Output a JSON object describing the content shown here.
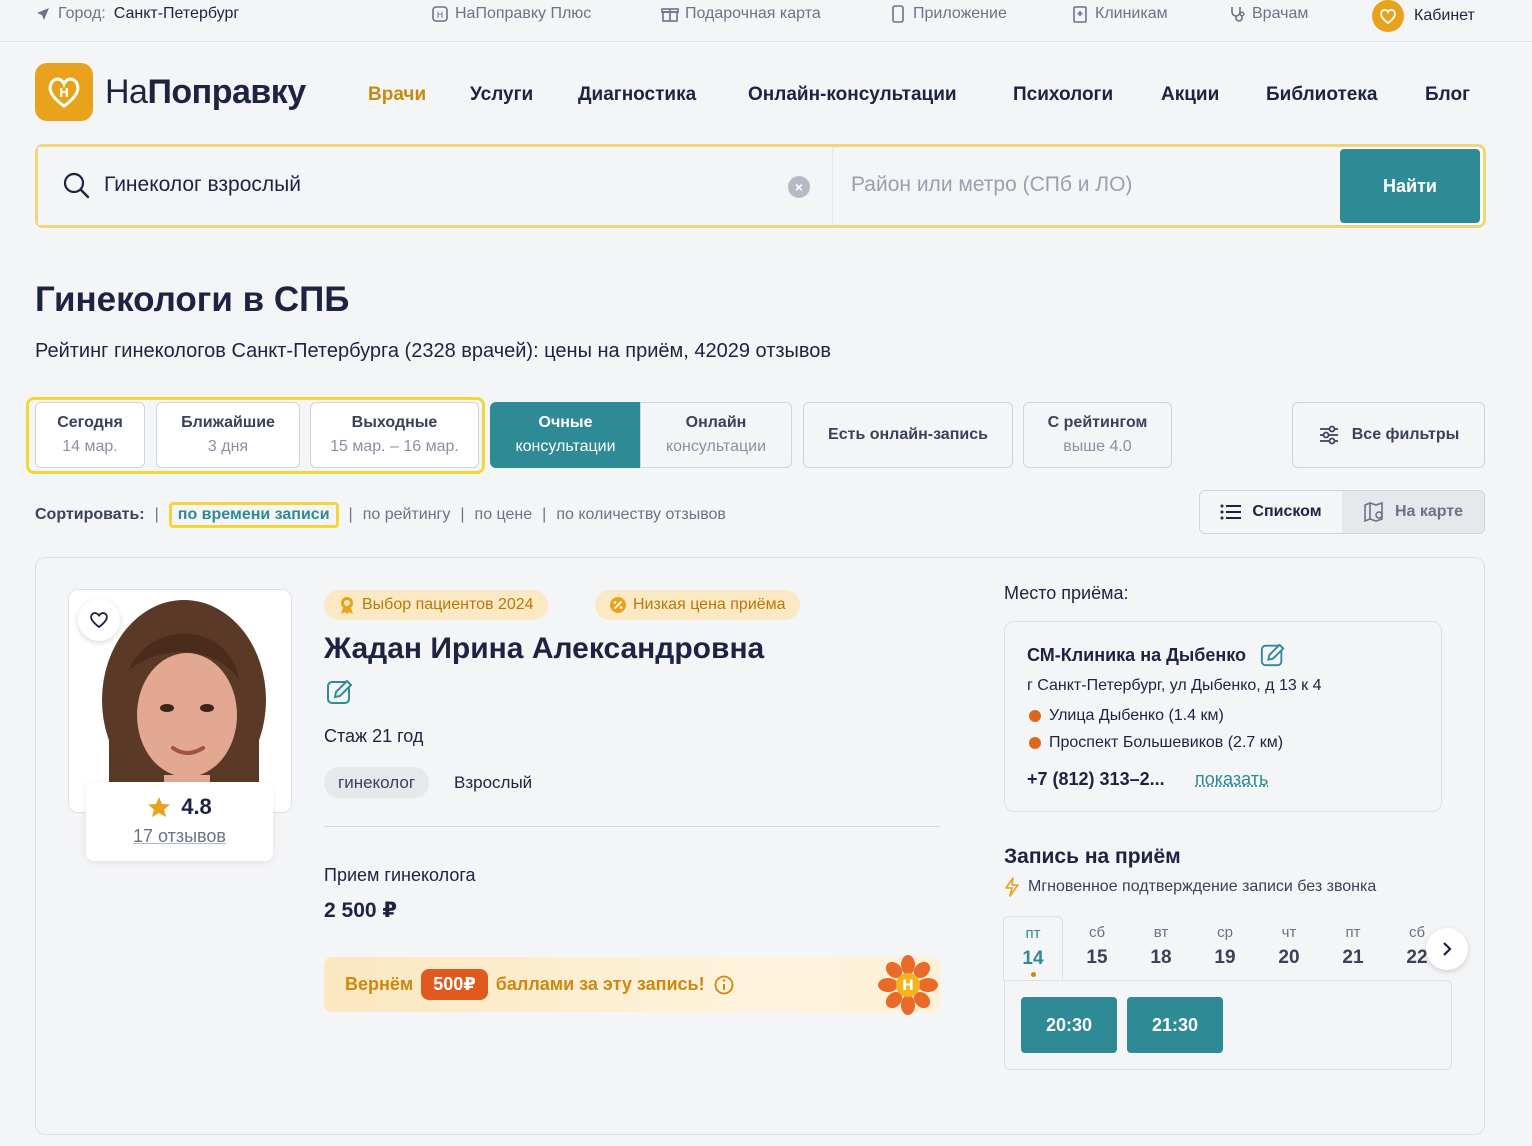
{
  "topbar": {
    "city_label": "Город:",
    "city": "Санкт-Петербург",
    "links": [
      "НаПоправку Плюс",
      "Подарочная карта",
      "Приложение",
      "Клиникам",
      "Врачам"
    ],
    "cabinet": "Кабинет"
  },
  "logo": {
    "part1": "На",
    "part2": "Поправку"
  },
  "nav": [
    "Врачи",
    "Услуги",
    "Диагностика",
    "Онлайн-консультации",
    "Психологи",
    "Акции",
    "Библиотека",
    "Блог"
  ],
  "search": {
    "query": "Гинеколог взрослый",
    "location_placeholder": "Район или метро (СПб и ЛО)",
    "button": "Найти"
  },
  "page": {
    "title": "Гинекологи в СПБ",
    "subtitle": "Рейтинг гинекологов Санкт-Петербурга (2328 врачей): цены на приём, 42029 отзывов"
  },
  "filters": {
    "today": {
      "label": "Сегодня",
      "sub": "14 мар."
    },
    "nearest": {
      "label": "Ближайшие",
      "sub": "3 дня"
    },
    "weekend": {
      "label": "Выходные",
      "sub": "15 мар. – 16 мар."
    },
    "inperson": {
      "label": "Очные",
      "sub": "консультации"
    },
    "online": {
      "label": "Онлайн",
      "sub": "консультации"
    },
    "online_booking": "Есть онлайн-запись",
    "rating": {
      "label": "С рейтингом",
      "sub": "выше 4.0"
    },
    "all": "Все фильтры"
  },
  "sort": {
    "label": "Сортировать:",
    "options": [
      "по времени записи",
      "по рейтингу",
      "по цене",
      "по количеству отзывов"
    ]
  },
  "view": {
    "list": "Списком",
    "map": "На карте"
  },
  "doctor": {
    "badges": [
      "Выбор пациентов 2024",
      "Низкая цена приёма"
    ],
    "name": "Жадан Ирина Александровна",
    "experience": "Стаж 21 год",
    "specialty": "гинеколог",
    "age_group": "Взрослый",
    "rating": "4.8",
    "reviews": "17 отзывов",
    "service": "Прием гинеколога",
    "price": "2 500 ₽",
    "promo": {
      "before": "Вернём",
      "points": "500₽",
      "after": "баллами за эту запись!"
    }
  },
  "place": {
    "label": "Место приёма:",
    "clinic": "СМ-Клиника на Дыбенко",
    "address": "г Санкт-Петербург, ул Дыбенко, д 13 к 4",
    "metro": [
      "Улица Дыбенко (1.4 км)",
      "Проспект Большевиков (2.7 км)"
    ],
    "phone": "+7 (812) 313–2...",
    "show": "показать"
  },
  "booking": {
    "title": "Запись на приём",
    "instant": "Мгновенное подтверждение записи без звонка",
    "days": [
      {
        "w": "пт",
        "n": "14"
      },
      {
        "w": "сб",
        "n": "15"
      },
      {
        "w": "вт",
        "n": "18"
      },
      {
        "w": "ср",
        "n": "19"
      },
      {
        "w": "чт",
        "n": "20"
      },
      {
        "w": "пт",
        "n": "21"
      },
      {
        "w": "сб",
        "n": "22"
      }
    ],
    "slots": [
      "20:30",
      "21:30"
    ]
  },
  "colors": {
    "accent": "#2e8a94",
    "brand": "#e8a21c",
    "highlight": "#f3d73a"
  }
}
